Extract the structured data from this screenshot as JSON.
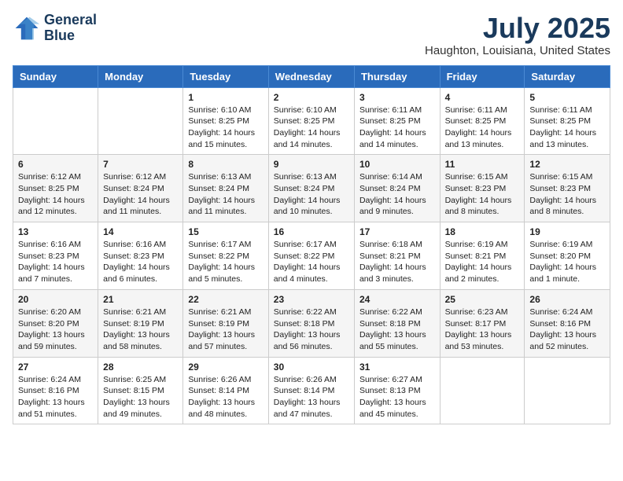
{
  "header": {
    "logo_line1": "General",
    "logo_line2": "Blue",
    "month_title": "July 2025",
    "location": "Haughton, Louisiana, United States"
  },
  "weekdays": [
    "Sunday",
    "Monday",
    "Tuesday",
    "Wednesday",
    "Thursday",
    "Friday",
    "Saturday"
  ],
  "weeks": [
    [
      {
        "day": "",
        "info": ""
      },
      {
        "day": "",
        "info": ""
      },
      {
        "day": "1",
        "info": "Sunrise: 6:10 AM\nSunset: 8:25 PM\nDaylight: 14 hours and 15 minutes."
      },
      {
        "day": "2",
        "info": "Sunrise: 6:10 AM\nSunset: 8:25 PM\nDaylight: 14 hours and 14 minutes."
      },
      {
        "day": "3",
        "info": "Sunrise: 6:11 AM\nSunset: 8:25 PM\nDaylight: 14 hours and 14 minutes."
      },
      {
        "day": "4",
        "info": "Sunrise: 6:11 AM\nSunset: 8:25 PM\nDaylight: 14 hours and 13 minutes."
      },
      {
        "day": "5",
        "info": "Sunrise: 6:11 AM\nSunset: 8:25 PM\nDaylight: 14 hours and 13 minutes."
      }
    ],
    [
      {
        "day": "6",
        "info": "Sunrise: 6:12 AM\nSunset: 8:25 PM\nDaylight: 14 hours and 12 minutes."
      },
      {
        "day": "7",
        "info": "Sunrise: 6:12 AM\nSunset: 8:24 PM\nDaylight: 14 hours and 11 minutes."
      },
      {
        "day": "8",
        "info": "Sunrise: 6:13 AM\nSunset: 8:24 PM\nDaylight: 14 hours and 11 minutes."
      },
      {
        "day": "9",
        "info": "Sunrise: 6:13 AM\nSunset: 8:24 PM\nDaylight: 14 hours and 10 minutes."
      },
      {
        "day": "10",
        "info": "Sunrise: 6:14 AM\nSunset: 8:24 PM\nDaylight: 14 hours and 9 minutes."
      },
      {
        "day": "11",
        "info": "Sunrise: 6:15 AM\nSunset: 8:23 PM\nDaylight: 14 hours and 8 minutes."
      },
      {
        "day": "12",
        "info": "Sunrise: 6:15 AM\nSunset: 8:23 PM\nDaylight: 14 hours and 8 minutes."
      }
    ],
    [
      {
        "day": "13",
        "info": "Sunrise: 6:16 AM\nSunset: 8:23 PM\nDaylight: 14 hours and 7 minutes."
      },
      {
        "day": "14",
        "info": "Sunrise: 6:16 AM\nSunset: 8:23 PM\nDaylight: 14 hours and 6 minutes."
      },
      {
        "day": "15",
        "info": "Sunrise: 6:17 AM\nSunset: 8:22 PM\nDaylight: 14 hours and 5 minutes."
      },
      {
        "day": "16",
        "info": "Sunrise: 6:17 AM\nSunset: 8:22 PM\nDaylight: 14 hours and 4 minutes."
      },
      {
        "day": "17",
        "info": "Sunrise: 6:18 AM\nSunset: 8:21 PM\nDaylight: 14 hours and 3 minutes."
      },
      {
        "day": "18",
        "info": "Sunrise: 6:19 AM\nSunset: 8:21 PM\nDaylight: 14 hours and 2 minutes."
      },
      {
        "day": "19",
        "info": "Sunrise: 6:19 AM\nSunset: 8:20 PM\nDaylight: 14 hours and 1 minute."
      }
    ],
    [
      {
        "day": "20",
        "info": "Sunrise: 6:20 AM\nSunset: 8:20 PM\nDaylight: 13 hours and 59 minutes."
      },
      {
        "day": "21",
        "info": "Sunrise: 6:21 AM\nSunset: 8:19 PM\nDaylight: 13 hours and 58 minutes."
      },
      {
        "day": "22",
        "info": "Sunrise: 6:21 AM\nSunset: 8:19 PM\nDaylight: 13 hours and 57 minutes."
      },
      {
        "day": "23",
        "info": "Sunrise: 6:22 AM\nSunset: 8:18 PM\nDaylight: 13 hours and 56 minutes."
      },
      {
        "day": "24",
        "info": "Sunrise: 6:22 AM\nSunset: 8:18 PM\nDaylight: 13 hours and 55 minutes."
      },
      {
        "day": "25",
        "info": "Sunrise: 6:23 AM\nSunset: 8:17 PM\nDaylight: 13 hours and 53 minutes."
      },
      {
        "day": "26",
        "info": "Sunrise: 6:24 AM\nSunset: 8:16 PM\nDaylight: 13 hours and 52 minutes."
      }
    ],
    [
      {
        "day": "27",
        "info": "Sunrise: 6:24 AM\nSunset: 8:16 PM\nDaylight: 13 hours and 51 minutes."
      },
      {
        "day": "28",
        "info": "Sunrise: 6:25 AM\nSunset: 8:15 PM\nDaylight: 13 hours and 49 minutes."
      },
      {
        "day": "29",
        "info": "Sunrise: 6:26 AM\nSunset: 8:14 PM\nDaylight: 13 hours and 48 minutes."
      },
      {
        "day": "30",
        "info": "Sunrise: 6:26 AM\nSunset: 8:14 PM\nDaylight: 13 hours and 47 minutes."
      },
      {
        "day": "31",
        "info": "Sunrise: 6:27 AM\nSunset: 8:13 PM\nDaylight: 13 hours and 45 minutes."
      },
      {
        "day": "",
        "info": ""
      },
      {
        "day": "",
        "info": ""
      }
    ]
  ]
}
